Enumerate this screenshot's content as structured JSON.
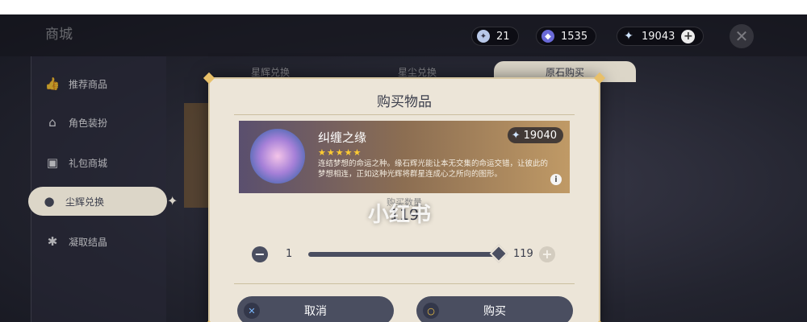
{
  "header": {
    "shop_title": "商城",
    "subtitle": "",
    "currencies": [
      {
        "icon": "fate-icon",
        "value": "21"
      },
      {
        "icon": "starglitter-icon",
        "value": "1535"
      },
      {
        "icon": "primogem-icon",
        "value": "19043"
      }
    ]
  },
  "sidebar": {
    "items": [
      {
        "label": "推荐商品",
        "icon": "thumbs-up-icon"
      },
      {
        "label": "角色装扮",
        "icon": "hanger-icon"
      },
      {
        "label": "礼包商城",
        "icon": "gift-icon"
      },
      {
        "label": "尘辉兑换",
        "icon": "pouch-icon"
      },
      {
        "label": "凝取结晶",
        "icon": "crystal-icon"
      }
    ],
    "active_index": 3
  },
  "tabs": [
    {
      "label": "星辉兑换"
    },
    {
      "label": "星尘兑换"
    },
    {
      "label": "原石购买"
    }
  ],
  "active_tab": 2,
  "modal": {
    "title": "购买物品",
    "item": {
      "name": "纠缠之缘",
      "stars": "★★★★★",
      "price": "19040",
      "description": "连结梦想的命运之种。缘石辉光能让本无交集的命运交错，让彼此的梦想相连，正如这种光辉将群星连成心之所向的图形。"
    },
    "quantity_label": "购买数量",
    "quantity": "119",
    "slider": {
      "min": "1",
      "max": "119",
      "fraction": 1.0
    },
    "cancel_label": "取消",
    "confirm_label": "购买"
  },
  "watermark": "小红书",
  "colors": {
    "accent_gold": "#e8c06a",
    "button_dark": "#4a4e60",
    "panel_cream": "#ece5d8",
    "star_yellow": "#ffcc32"
  }
}
